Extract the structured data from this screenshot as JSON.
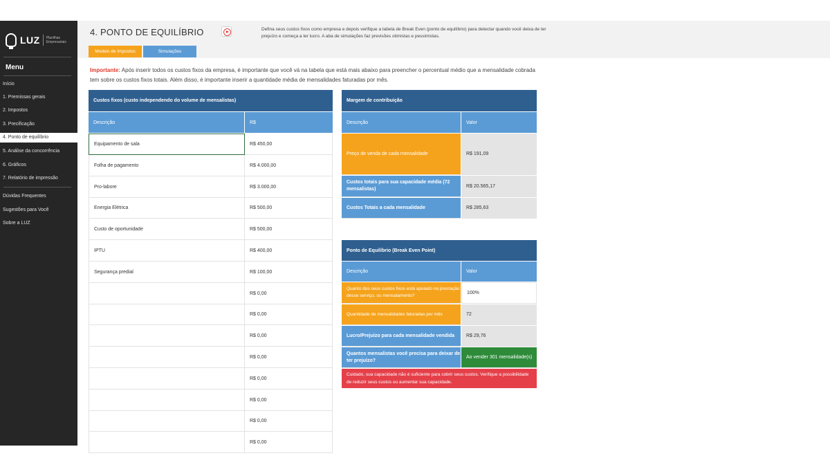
{
  "app": {
    "logo_text": "LUZ",
    "logo_subtitle": "Planilhas Empresariais"
  },
  "sidebar": {
    "menu_title": "Menu",
    "items": [
      {
        "label": "Início"
      },
      {
        "label": "1. Premissas gerais"
      },
      {
        "label": "2. Impostos"
      },
      {
        "label": "3. Precificação"
      },
      {
        "label": "4. Ponto de equilíbrio"
      },
      {
        "label": "5. Análise da concorrência"
      },
      {
        "label": "6. Gráficos"
      },
      {
        "label": "7. Relatório de impressão"
      }
    ],
    "extra_items": [
      {
        "label": "Dúvidas Frequentes"
      },
      {
        "label": "Sugestões para Você"
      },
      {
        "label": "Sobre a LUZ"
      }
    ]
  },
  "header": {
    "title": "4. PONTO DE EQUILÍBRIO",
    "description": "Defina seus custos fixos como empresa e depois verifique a tabela de Break Even (ponto de equilíbrio) para detectar quando você deixa de ter prejuízo e começa a ter lucro. A aba de simulações faz previsões otimistas e pessimistas."
  },
  "tabs": [
    {
      "label": "Modelo de Impostos"
    },
    {
      "label": "Simulações"
    }
  ],
  "important": {
    "label": "Importante:",
    "text": " Após inserir todos os custos fixos da empresa, é importante que você vá na tabela que está mais abaixo para preencher o percentual médio que a mensalidade cobrada tem sobre os custos fixos totais. Além disso, é importante inserir a quantidade média de mensalidades faturadas por mês."
  },
  "fixed_costs": {
    "title": "Custos fixos (custo independendo do volume de mensalistas)",
    "col_desc": "Descrição",
    "col_value": "R$",
    "rows": [
      {
        "desc": "Equipamento de sala",
        "value": "R$ 450,00"
      },
      {
        "desc": "Folha de pagamento",
        "value": "R$ 4.000,00"
      },
      {
        "desc": "Pro-labore",
        "value": "R$ 3.000,00"
      },
      {
        "desc": "Energia Elétrica",
        "value": "R$ 500,00"
      },
      {
        "desc": "Custo de oportunidade",
        "value": "R$ 500,00"
      },
      {
        "desc": "IPTU",
        "value": "R$ 400,00"
      },
      {
        "desc": "Segurança predial",
        "value": "R$ 100,00"
      },
      {
        "desc": "",
        "value": "R$ 0,00"
      },
      {
        "desc": "",
        "value": "R$ 0,00"
      },
      {
        "desc": "",
        "value": "R$ 0,00"
      },
      {
        "desc": "",
        "value": "R$ 0,00"
      },
      {
        "desc": "",
        "value": "R$ 0,00"
      },
      {
        "desc": "",
        "value": "R$ 0,00"
      },
      {
        "desc": "",
        "value": "R$ 0,00"
      },
      {
        "desc": "",
        "value": "R$ 0,00"
      }
    ]
  },
  "contribution_margin": {
    "title": "Margem de contribuição",
    "col_desc": "Descrição",
    "col_value": "Valor",
    "rows": [
      {
        "desc": "Preço de venda de cada mensalidade",
        "value": "R$ 191,09"
      },
      {
        "desc": "Custos totais para sua capacidade média (72 mensalistas)",
        "value": "R$ 20.565,17"
      },
      {
        "desc": "Custos Totais a cada mensalidade",
        "value": "R$ 285,63"
      }
    ]
  },
  "break_even": {
    "title": "Ponto de Equilíbrio (Break Even Point)",
    "col_desc": "Descrição",
    "col_value": "Valor",
    "rows": [
      {
        "desc": "Quanto dos seus custos fixos está apoiado na prestação desse serviço, ou mensalamento?",
        "value": "100%"
      },
      {
        "desc": "Quantidade de mensalidades faturadas por mês",
        "value": "72"
      },
      {
        "desc": "Lucro/Prejuízo para cada mensalidade vendida",
        "value": "R$ 29,76"
      },
      {
        "desc": "Quantos mensalistas você precisa para deixar de ter prejuízo?",
        "value": "Ao vender 301 mensalidade(s)"
      }
    ],
    "alert": "Cuidado, sua capacidade não é suficiente para cobrir seus custos. Verifique a possibilidade de reduzir seus custos ou aumentar sua capacidade."
  },
  "colors": {
    "sidebar_bg": "#262626",
    "header_blue": "#2f5f8f",
    "column_blue": "#5b9bd5",
    "accent_orange": "#f5a31c",
    "success_green": "#2e8b3a",
    "alert_red": "#e5404a"
  }
}
